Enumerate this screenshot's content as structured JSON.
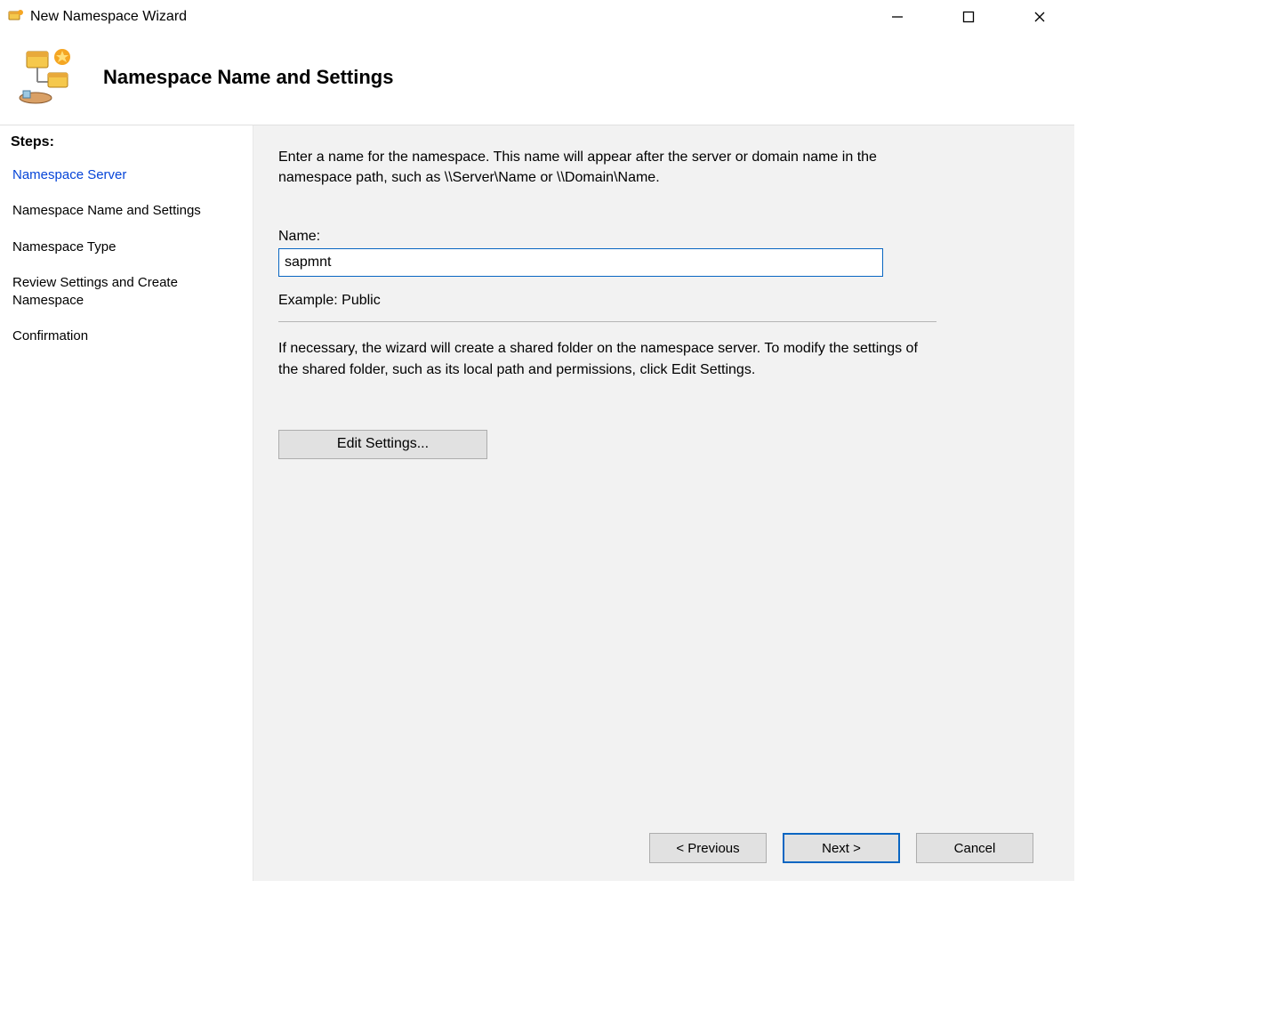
{
  "window": {
    "title": "New Namespace Wizard"
  },
  "header": {
    "title": "Namespace Name and Settings"
  },
  "sidebar": {
    "heading": "Steps:",
    "items": [
      {
        "label": "Namespace Server",
        "state": "visited"
      },
      {
        "label": "Namespace Name and Settings",
        "state": "current"
      },
      {
        "label": "Namespace Type",
        "state": "upcoming"
      },
      {
        "label": "Review Settings and Create Namespace",
        "state": "upcoming"
      },
      {
        "label": "Confirmation",
        "state": "upcoming"
      }
    ]
  },
  "main": {
    "intro": "Enter a name for the namespace. This name will appear after the server or domain name in the namespace path, such as \\\\Server\\Name or \\\\Domain\\Name.",
    "name_label": "Name:",
    "name_value": "sapmnt",
    "example": "Example: Public",
    "info": "If necessary, the wizard will create a shared folder on the namespace server. To modify the settings of the shared folder, such as its local path and permissions, click Edit Settings.",
    "edit_settings_label": "Edit Settings..."
  },
  "buttons": {
    "previous": "< Previous",
    "next": "Next >",
    "cancel": "Cancel"
  }
}
